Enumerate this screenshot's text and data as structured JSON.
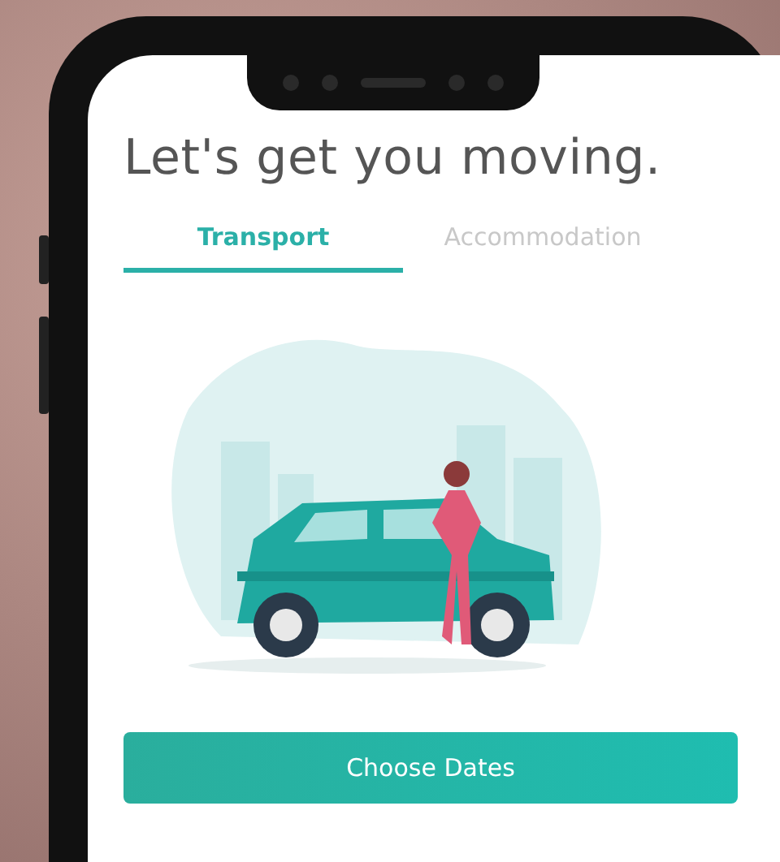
{
  "screen": {
    "title": "Let's get you moving."
  },
  "tabs": [
    {
      "label": "Transport",
      "selected": true
    },
    {
      "label": "Accommodation",
      "selected": false
    }
  ],
  "primary_button": {
    "label": "Choose Dates"
  }
}
